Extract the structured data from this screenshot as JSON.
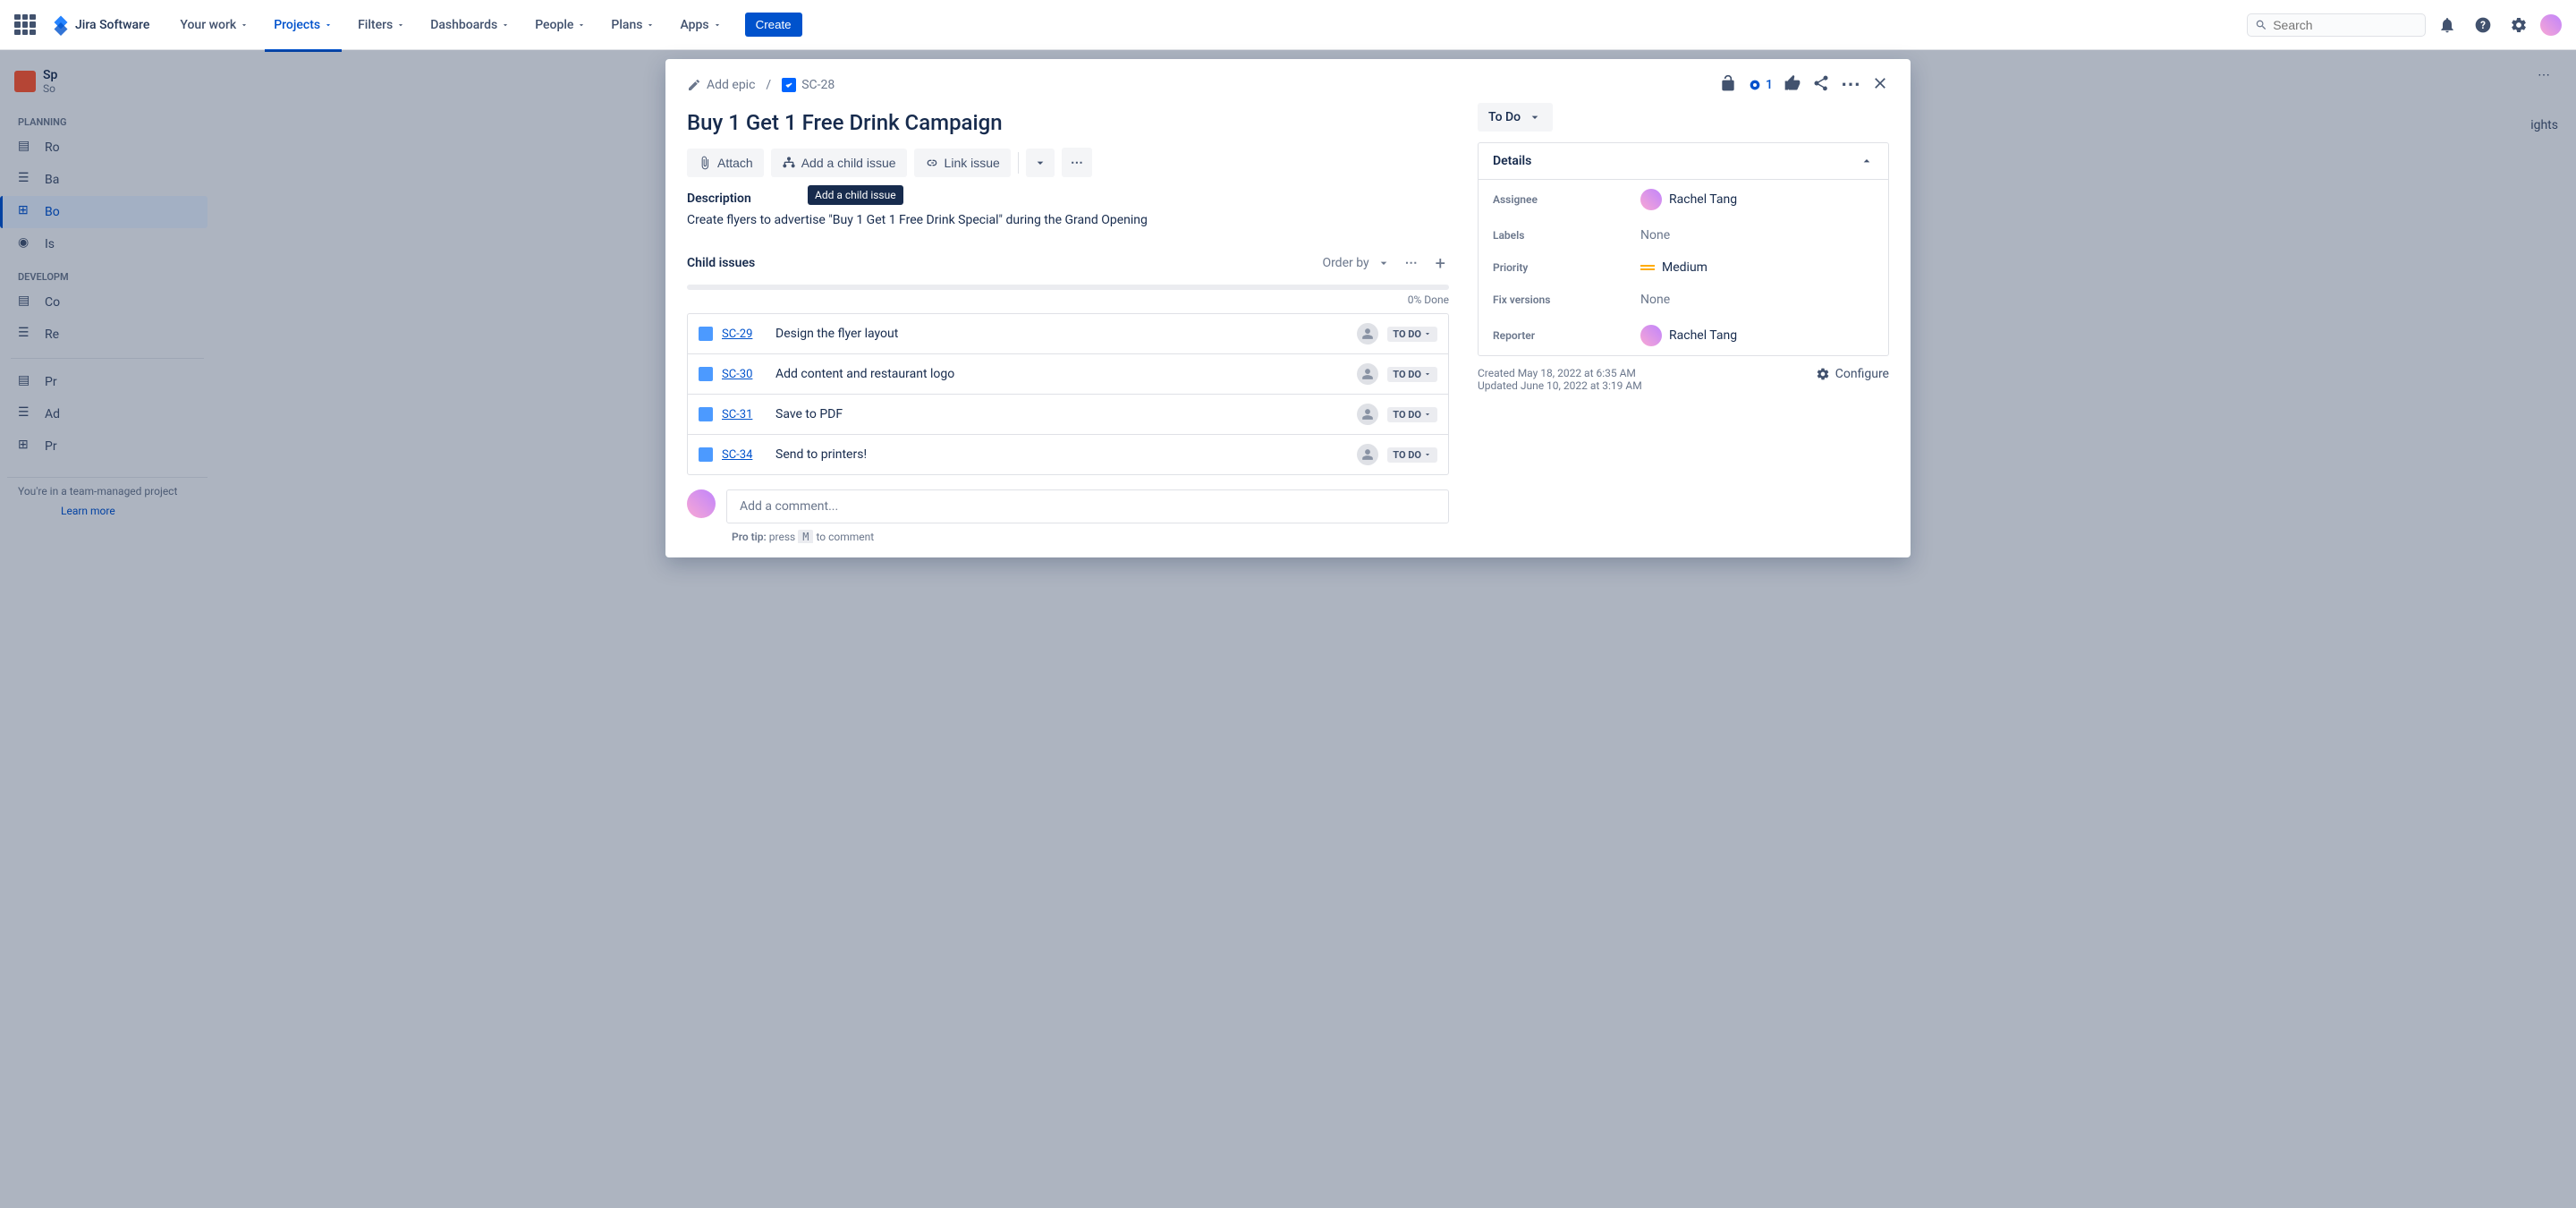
{
  "topbar": {
    "product": "Jira Software",
    "nav": [
      "Your work",
      "Projects",
      "Filters",
      "Dashboards",
      "People",
      "Plans",
      "Apps"
    ],
    "active_nav": 1,
    "create": "Create",
    "search_placeholder": "Search"
  },
  "sidebar": {
    "project_name": "Sp",
    "project_sub": "So",
    "planning_label": "PLANNING",
    "planning_items": [
      "Ro",
      "Ba",
      "Bo",
      "Is"
    ],
    "planning_active": 2,
    "dev_label": "DEVELOPM",
    "dev_items": [
      "Co",
      "Re"
    ],
    "bottom_items": [
      "Pr",
      "Ad",
      "Pr"
    ],
    "team_note": "You're in a team-managed project",
    "learn_more": "Learn more"
  },
  "issue": {
    "add_epic": "Add epic",
    "key": "SC-28",
    "title": "Buy 1 Get 1 Free Drink Campaign",
    "attach": "Attach",
    "add_child": "Add a child issue",
    "link_issue": "Link issue",
    "tooltip": "Add a child issue",
    "desc_label": "Description",
    "description": "Create flyers to advertise \"Buy 1 Get 1 Free Drink Special\" during the Grand Opening",
    "child_label": "Child issues",
    "order_by": "Order by",
    "progress": "0% Done",
    "children": [
      {
        "key": "SC-29",
        "summary": "Design the flyer layout",
        "status": "TO DO"
      },
      {
        "key": "SC-30",
        "summary": "Add content and restaurant logo",
        "status": "TO DO"
      },
      {
        "key": "SC-31",
        "summary": "Save to PDF",
        "status": "TO DO"
      },
      {
        "key": "SC-34",
        "summary": "Send to printers!",
        "status": "TO DO"
      }
    ],
    "comment_placeholder": "Add a comment...",
    "pro_tip_label": "Pro tip:",
    "pro_tip_press": "press",
    "pro_tip_key": "M",
    "pro_tip_rest": "to comment",
    "watch_count": "1"
  },
  "side": {
    "status": "To Do",
    "details_label": "Details",
    "assignee_label": "Assignee",
    "assignee": "Rachel Tang",
    "labels_label": "Labels",
    "labels_val": "None",
    "priority_label": "Priority",
    "priority_val": "Medium",
    "fixv_label": "Fix versions",
    "fixv_val": "None",
    "reporter_label": "Reporter",
    "reporter": "Rachel Tang",
    "created": "Created May 18, 2022 at 6:35 AM",
    "updated": "Updated June 10, 2022 at 3:19 AM",
    "configure": "Configure"
  },
  "bg": {
    "insights": "ights"
  }
}
